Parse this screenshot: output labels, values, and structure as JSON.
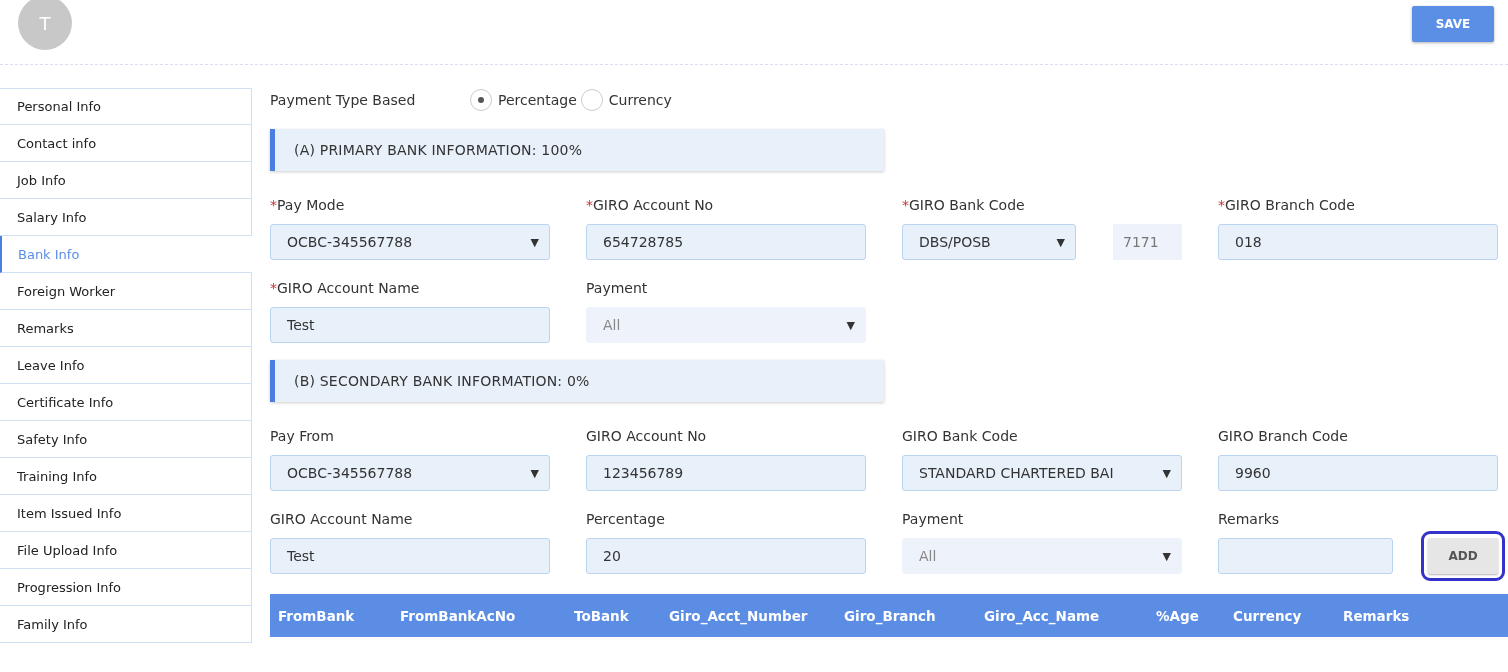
{
  "header": {
    "avatar_initial": "T",
    "save_button": "SAVE"
  },
  "sidebar": {
    "items": [
      {
        "label": "Personal Info",
        "selected": false
      },
      {
        "label": "Contact info",
        "selected": false
      },
      {
        "label": "Job Info",
        "selected": false
      },
      {
        "label": "Salary Info",
        "selected": false
      },
      {
        "label": "Bank Info",
        "selected": true
      },
      {
        "label": "Foreign Worker",
        "selected": false
      },
      {
        "label": "Remarks",
        "selected": false
      },
      {
        "label": "Leave Info",
        "selected": false
      },
      {
        "label": "Certificate Info",
        "selected": false
      },
      {
        "label": "Safety Info",
        "selected": false
      },
      {
        "label": "Training Info",
        "selected": false
      },
      {
        "label": "Item Issued Info",
        "selected": false
      },
      {
        "label": "File Upload Info",
        "selected": false
      },
      {
        "label": "Progression Info",
        "selected": false
      },
      {
        "label": "Family Info",
        "selected": false
      }
    ]
  },
  "payment_type": {
    "label": "Payment Type Based",
    "options": [
      {
        "label": "Percentage",
        "selected": true
      },
      {
        "label": "Currency",
        "selected": false
      }
    ]
  },
  "sections": [
    {
      "title": "(A) PRIMARY BANK INFORMATION: 100%",
      "rows": [
        [
          {
            "kind": "select",
            "label": "Pay Mode",
            "required": true,
            "value": "OCBC-345567788",
            "disabled": false
          },
          {
            "kind": "input",
            "label": "GIRO Account No",
            "required": true,
            "value": "654728785",
            "disabled": false
          },
          {
            "kind": "select_code",
            "label": "GIRO Bank Code",
            "required": true,
            "value": "DBS/POSB",
            "code": "7171",
            "disabled": false
          },
          {
            "kind": "input",
            "label": "GIRO Branch Code",
            "required": true,
            "value": "018",
            "disabled": false
          }
        ],
        [
          {
            "kind": "input",
            "label": "GIRO Account Name",
            "required": true,
            "value": "Test",
            "disabled": false
          },
          {
            "kind": "select",
            "label": "Payment",
            "required": false,
            "value": "All",
            "disabled": true
          }
        ]
      ]
    },
    {
      "title": "(B) SECONDARY BANK INFORMATION: 0%",
      "rows": [
        [
          {
            "kind": "select",
            "label": "Pay From",
            "required": false,
            "value": "OCBC-345567788",
            "disabled": false
          },
          {
            "kind": "input",
            "label": "GIRO Account No",
            "required": false,
            "value": "123456789",
            "disabled": false
          },
          {
            "kind": "select",
            "label": "GIRO Bank Code",
            "required": false,
            "value": "STANDARD CHARTERED BAI",
            "disabled": false
          },
          {
            "kind": "input",
            "label": "GIRO Branch Code",
            "required": false,
            "value": "9960",
            "disabled": false
          }
        ],
        [
          {
            "kind": "input",
            "label": "GIRO Account Name",
            "required": false,
            "value": "Test",
            "disabled": false
          },
          {
            "kind": "input",
            "label": "Percentage",
            "required": false,
            "value": "20",
            "disabled": false
          },
          {
            "kind": "select",
            "label": "Payment",
            "required": false,
            "value": "All",
            "disabled": true
          },
          {
            "kind": "input_button",
            "label": "Remarks",
            "required": false,
            "disabled": false,
            "button": "ADD"
          }
        ]
      ]
    }
  ],
  "required_mark": "*",
  "select_arrow": "▼",
  "table": {
    "columns": [
      "FromBank",
      "FromBankAcNo",
      "ToBank",
      "Giro_Acct_Number",
      "Giro_Branch",
      "Giro_Acc_Name",
      "%Age",
      "Currency",
      "Remarks"
    ]
  }
}
